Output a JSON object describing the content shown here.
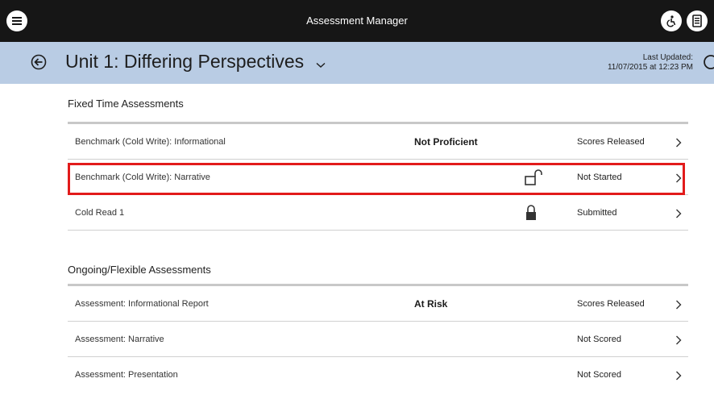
{
  "app": {
    "title": "Assessment Manager"
  },
  "header": {
    "unit_title": "Unit 1: Differing Perspectives",
    "last_updated_label": "Last Updated:",
    "last_updated_value": "11/07/2015 at 12:23 PM"
  },
  "sections": [
    {
      "title": "Fixed Time Assessments",
      "rows": [
        {
          "name": "Benchmark (Cold Write): Informational",
          "score": "Not Proficient",
          "lock": "",
          "status": "Scores Released"
        },
        {
          "name": "Benchmark (Cold Write): Narrative",
          "score": "",
          "lock": "unlocked-icon",
          "status": "Not Started",
          "highlighted": true
        },
        {
          "name": "Cold Read 1",
          "score": "",
          "lock": "locked-icon",
          "status": "Submitted"
        }
      ]
    },
    {
      "title": "Ongoing/Flexible Assessments",
      "rows": [
        {
          "name": "Assessment: Informational Report",
          "score": "At Risk",
          "lock": "",
          "status": "Scores Released"
        },
        {
          "name": "Assessment: Narrative",
          "score": "",
          "lock": "",
          "status": "Not Scored"
        },
        {
          "name": "Assessment: Presentation",
          "score": "",
          "lock": "",
          "status": "Not Scored"
        }
      ]
    }
  ],
  "colors": {
    "topbar": "#161616",
    "subheader": "#b9cce4",
    "highlight": "#e21b1b"
  }
}
